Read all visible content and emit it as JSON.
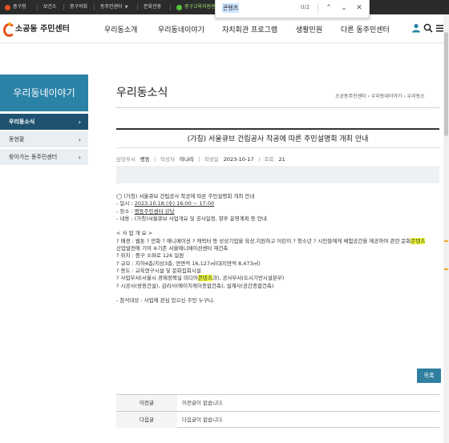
{
  "topbar": {
    "items": [
      {
        "label": "중구청",
        "icon_color": "#e8501c"
      },
      {
        "label": "보건소"
      },
      {
        "label": "중구의회"
      },
      {
        "label": "동주민센터",
        "caret": "▼"
      },
      {
        "label": "문화관광"
      },
      {
        "label": "중구교육지원센",
        "icon_color": "#55c23a"
      }
    ]
  },
  "findbar": {
    "query": "콘텐츠",
    "count": "0/2",
    "prev": "⌃",
    "next": "⌄",
    "close": "✕"
  },
  "header": {
    "site_name": "소공동 주민센터",
    "menu": [
      "우리동소개",
      "우리동네이야기",
      "자치회관 프로그램",
      "생활민원",
      "다른 동주민센터"
    ]
  },
  "sidebar": {
    "title": "우리동네이야기",
    "items": [
      {
        "label": "우리동소식",
        "active": true,
        "arrow": "›"
      },
      {
        "label": "동현황",
        "arrow": "›"
      },
      {
        "label": "찾아가는 동주민센터",
        "arrow": "›"
      }
    ]
  },
  "main": {
    "page_title": "우리동소식",
    "breadcrumb": "소공동주민센터 › 우리동네이야기 › 우리동소",
    "post": {
      "title": "(가칭) 서울큐브 건립공사 착공에 따른 주민설명회 개최 안내",
      "dept_label": "담당부서",
      "dept": "명동",
      "author_label": "작성자",
      "author": "이나리",
      "date_label": "작성일",
      "date": "2023-10-17",
      "views_label": "조회",
      "views": "21",
      "lines": {
        "l1": "◯ (가칭) 서울큐브 건립공사 착공에 따른 주민설명회 개최 안내",
        "l2a": " - 일시 : ",
        "l2b": "2023.10.18.(수) 16:00 ~ 17:00",
        "l3a": " - 장소 : ",
        "l3b": "명동주민센터 강당",
        "l4": " - 내용 : (가칭)서울큐브 사업개요 및 공사일정, 향후 운영계획 등 안내",
        "l5": "< 사 업 개 요 >",
        "l6a": " ? 배경 : 웹툰 ? 만화 ? 애니메이션 ? 캐릭터 등 상상기업을 육성.지원하고 어린이 ? 청소년 ? 시민들에게 체험공간을 제공하여 관련 문화",
        "l6b": "콘텐츠",
        "l7": "산업발전에 기여 ※기존 서울애니메이션센터 재건축",
        "l8": " ? 위치 : 중구 소파로 126 일원",
        "l9": " ? 규모 : 지하4층/지상3층, 연면적 16,127㎡(대지면적 8,473㎡)",
        "l10": " ? 용도 : 교육연구시설 및 문화집회시설",
        "l11a": " ? 사업부서(서울시 경제정책실 미디어",
        "l11b": "콘텐츠",
        "l11c": "과), 공사부서(도시기반시설본부)",
        "l12": " ? 시공사(쌍용건설), 감리사(에이치케이종합건축), 설계사(공간종합건축)",
        "l13": " - 참석대상 : 사업에 관심 있으신 주민 누구나."
      }
    },
    "list_button": "목록",
    "prev_label": "이전글",
    "prev_text": "이전글이 없습니다.",
    "next_label": "다음글",
    "next_text": "다음글이 없습니다."
  },
  "colors": {
    "accent": "#2b82a7",
    "side_active": "#1f5270",
    "topbar": "#2b2b2b",
    "highlight": "#f4ff3a"
  }
}
